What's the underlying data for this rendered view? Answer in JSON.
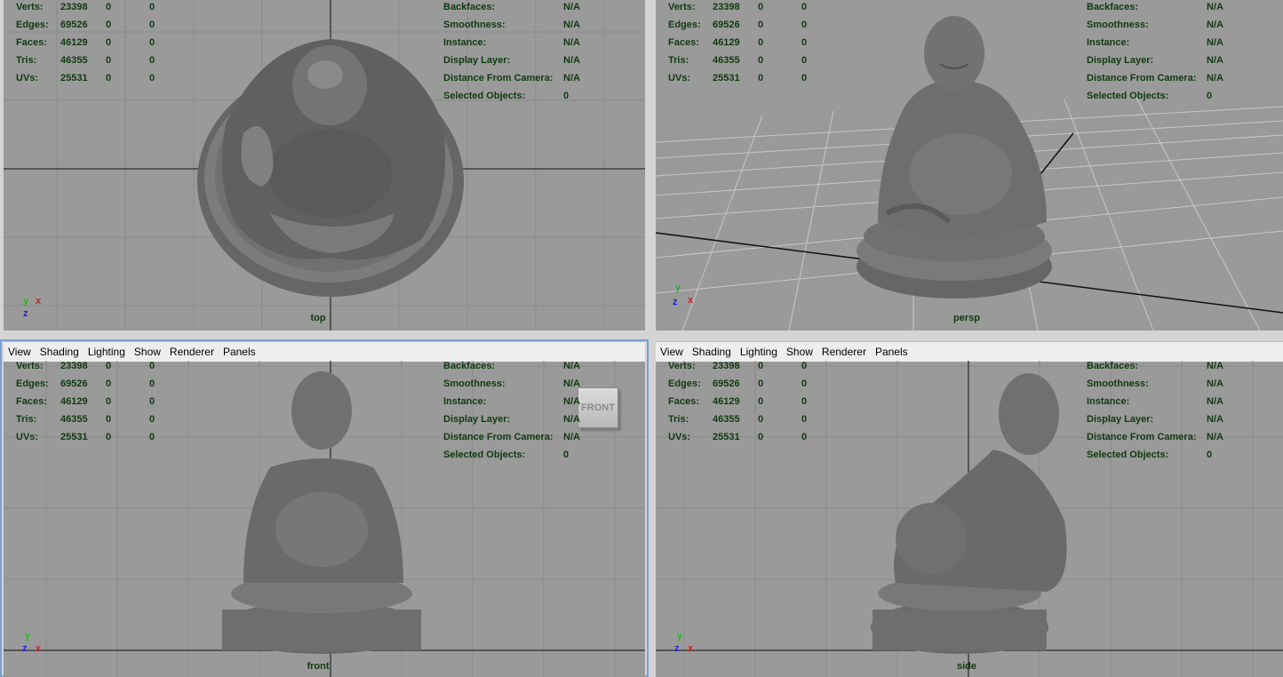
{
  "menu": [
    "View",
    "Shading",
    "Lighting",
    "Show",
    "Renderer",
    "Panels"
  ],
  "hud_left": [
    {
      "label": "Verts:",
      "v1": "23398",
      "v2": "0",
      "v3": "0"
    },
    {
      "label": "Edges:",
      "v1": "69526",
      "v2": "0",
      "v3": "0"
    },
    {
      "label": "Faces:",
      "v1": "46129",
      "v2": "0",
      "v3": "0"
    },
    {
      "label": "Tris:",
      "v1": "46355",
      "v2": "0",
      "v3": "0"
    },
    {
      "label": "UVs:",
      "v1": "25531",
      "v2": "0",
      "v3": "0"
    }
  ],
  "hud_right": [
    {
      "label": "Backfaces:",
      "value": "N/A"
    },
    {
      "label": "Smoothness:",
      "value": "N/A"
    },
    {
      "label": "Instance:",
      "value": "N/A"
    },
    {
      "label": "Display Layer:",
      "value": "N/A"
    },
    {
      "label": "Distance From Camera:",
      "value": "N/A"
    },
    {
      "label": "Selected Objects:",
      "value": "0"
    }
  ],
  "viewports": {
    "top": {
      "name": "top"
    },
    "persp": {
      "name": "persp"
    },
    "front": {
      "name": "front"
    },
    "side": {
      "name": "side"
    }
  },
  "axes": {
    "x": "x",
    "y": "y",
    "z": "z"
  },
  "viewcube_label": "FRONT",
  "colors": {
    "hud_text": "#103a10",
    "viewport_bg": "#9a9a9a",
    "model": "#6e6e6e",
    "grid": "#7f7f7f"
  }
}
